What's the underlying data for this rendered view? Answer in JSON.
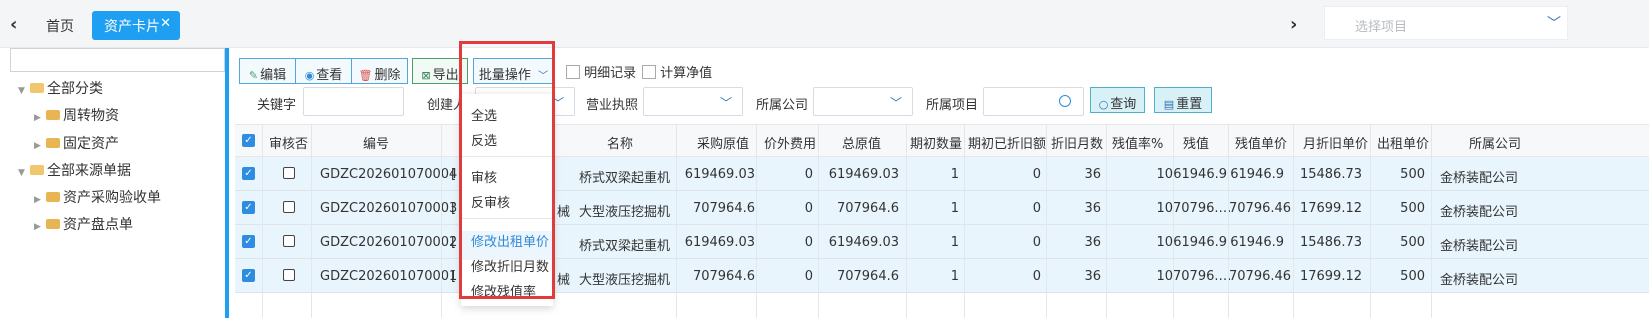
{
  "tabs": {
    "home": "首页",
    "active": "资产卡片",
    "close": "✕"
  },
  "project_select": {
    "placeholder": "选择项目"
  },
  "tree": [
    "全部分类",
    "周转物资",
    "固定资产",
    "全部来源单据",
    "资产采购验收单",
    "资产盘点单"
  ],
  "toolbar": {
    "edit": "编辑",
    "view": "查看",
    "delete": "删除",
    "export": "导出",
    "batch": "批量操作",
    "detail_record": "明细记录",
    "calc_net": "计算净值"
  },
  "filters": {
    "keyword": "关键字",
    "creator": "创建人",
    "license": "营业执照",
    "company": "所属公司",
    "project": "所属项目",
    "query": "查询",
    "reset": "重置"
  },
  "batch_menu": {
    "items": [
      "全选",
      "反选",
      "审核",
      "反审核",
      "修改出租单价",
      "修改折旧月数",
      "修改残值率"
    ],
    "highlighted": "修改出租单价"
  },
  "table": {
    "columns": [
      "审核否",
      "编号",
      "名称",
      "采购原值",
      "价外费用",
      "总原值",
      "期初数量",
      "期初已折旧额",
      "折旧月数",
      "残值率%",
      "残值",
      "残值单价",
      "月折旧单价",
      "出租单价",
      "所属公司"
    ],
    "rows": [
      {
        "code": "GDZC202601070004",
        "c1": "[",
        "name": "桥式双梁起重机",
        "purchase": "619469.03",
        "extra": "0",
        "total": "619469.03",
        "qty": "1",
        "dep_init": "0",
        "months": "36",
        "rate": "10",
        "residual": "61946.9",
        "res_unit": "61946.9",
        "monthly": "15486.73",
        "rent": "500",
        "company": "金桥装配公司"
      },
      {
        "code": "GDZC202601070003",
        "c1": "[",
        "c2": "械",
        "name": "大型液压挖掘机",
        "purchase": "707964.6",
        "extra": "0",
        "total": "707964.6",
        "qty": "1",
        "dep_init": "0",
        "months": "36",
        "rate": "10",
        "residual": "70796.…",
        "res_unit": "70796.46",
        "monthly": "17699.12",
        "rent": "500",
        "company": "金桥装配公司"
      },
      {
        "code": "GDZC202601070002",
        "c1": "[",
        "name": "桥式双梁起重机",
        "purchase": "619469.03",
        "extra": "0",
        "total": "619469.03",
        "qty": "1",
        "dep_init": "0",
        "months": "36",
        "rate": "10",
        "residual": "61946.9",
        "res_unit": "61946.9",
        "monthly": "15486.73",
        "rent": "500",
        "company": "金桥装配公司"
      },
      {
        "code": "GDZC202601070001",
        "c1": "[",
        "c2": "械",
        "name": "大型液压挖掘机",
        "purchase": "707964.6",
        "extra": "0",
        "total": "707964.6",
        "qty": "1",
        "dep_init": "0",
        "months": "36",
        "rate": "10",
        "residual": "70796.…",
        "res_unit": "70796.46",
        "monthly": "17699.12",
        "rent": "500",
        "company": "金桥装配公司"
      }
    ]
  },
  "colors": {
    "accent": "#1e9ff2",
    "highlight_box": "#e23b3b",
    "row_bg": "#e8f5fd"
  }
}
